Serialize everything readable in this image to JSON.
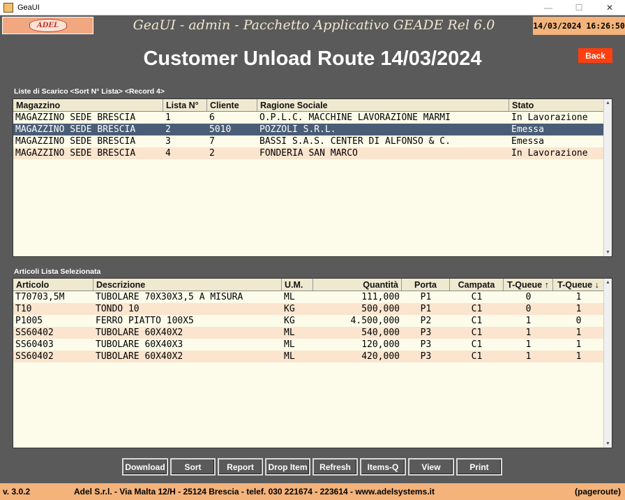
{
  "window": {
    "title": "GeaUI"
  },
  "header": {
    "logo_text": "ADEL",
    "title": "GeaUI - admin - Pacchetto Applicativo GEADE Rel 6.0",
    "datetime": "14/03/2024 16:26:50"
  },
  "page": {
    "title": "Customer Unload Route 14/03/2024",
    "back_label": "Back"
  },
  "lists": {
    "label": "Liste di Scarico <Sort N° Lista> <Record 4>",
    "columns": [
      "Magazzino",
      "Lista N°",
      "Cliente",
      "Ragione Sociale",
      "Stato"
    ],
    "rows": [
      [
        "MAGAZZINO SEDE BRESCIA",
        "1",
        "6",
        "O.P.L.C. MACCHINE LAVORAZIONE MARMI",
        "In Lavorazione"
      ],
      [
        "MAGAZZINO SEDE BRESCIA",
        "2",
        "5010",
        "POZZOLI S.R.L.",
        "Emessa"
      ],
      [
        "MAGAZZINO SEDE BRESCIA",
        "3",
        "7",
        "BASSI S.A.S. CENTER DI ALFONSO & C.",
        "Emessa"
      ],
      [
        "MAGAZZINO SEDE BRESCIA",
        "4",
        "2",
        "FONDERIA SAN MARCO",
        "In Lavorazione"
      ]
    ],
    "selected_row": 2
  },
  "items": {
    "label": "Articoli Lista Selezionata",
    "columns": [
      "Articolo",
      "Descrizione",
      "U.M.",
      "Quantità",
      "Porta",
      "Campata",
      "T-Queue ↑",
      "T-Queue ↓"
    ],
    "rows": [
      [
        "T70703,5M",
        "TUBOLARE 70X30X3,5 A MISURA",
        "ML",
        "111,000",
        "P1",
        "C1",
        "0",
        "1"
      ],
      [
        "T10",
        "TONDO 10",
        "KG",
        "500,000",
        "P1",
        "C1",
        "0",
        "1"
      ],
      [
        "P1005",
        "FERRO PIATTO 100X5",
        "KG",
        "4.500,000",
        "P2",
        "C1",
        "1",
        "0"
      ],
      [
        "SS60402",
        "TUBOLARE 60X40X2",
        "ML",
        "540,000",
        "P3",
        "C1",
        "1",
        "1"
      ],
      [
        "SS60403",
        "TUBOLARE 60X40X3",
        "ML",
        "120,000",
        "P3",
        "C1",
        "1",
        "1"
      ],
      [
        "SS60402",
        "TUBOLARE 60X40X2",
        "ML",
        "420,000",
        "P3",
        "C1",
        "1",
        "1"
      ]
    ]
  },
  "buttons": [
    {
      "name": "download-button",
      "label": "Download"
    },
    {
      "name": "sort-button",
      "label": "Sort"
    },
    {
      "name": "report-button",
      "label": "Report"
    },
    {
      "name": "drop-item-button",
      "label": "Drop Item"
    },
    {
      "name": "refresh-button",
      "label": "Refresh"
    },
    {
      "name": "items-q-button",
      "label": "Items-Q"
    },
    {
      "name": "view-button",
      "label": "View"
    },
    {
      "name": "print-button",
      "label": "Print"
    }
  ],
  "footer": {
    "version": "v. 3.0.2",
    "address": "Adel S.r.l. - Via Malta 12/H - 25124 Brescia - telef. 030 221674 - 223614 - www.adelsystems.it",
    "page_id": "(pageroute)"
  },
  "colors": {
    "background": "#5a5a5a",
    "accent_orange": "#f3b37b",
    "back_button": "#ff3f10",
    "selected_row": "#4a5d76",
    "alt_row": "#fbe5cf",
    "grid_bg": "#fdfcea"
  }
}
